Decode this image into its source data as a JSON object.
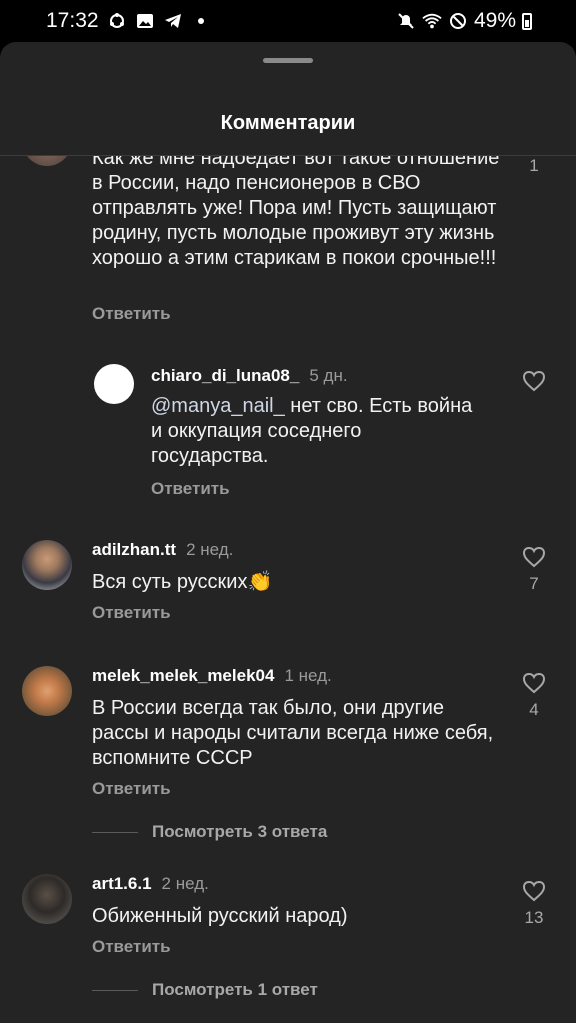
{
  "status": {
    "time": "17:32",
    "battery": "49%"
  },
  "sheet": {
    "title": "Комментарии"
  },
  "comments": [
    {
      "text": "Как же мне надоедает вот такое отношение в России, надо пенсионеров в СВО отправлять уже! Пора им! Пусть защищают родину, пусть молодые проживут эту жизнь хорошо а этим старикам в покои срочные!!!",
      "reply_label": "Ответить",
      "likes": "1"
    },
    {
      "username": "chiaro_di_luna08_",
      "time": "5 дн.",
      "mention": "@manya_nail_",
      "text": " нет сво. Есть война и оккупация соседнего государства.",
      "reply_label": "Ответить"
    },
    {
      "username": "adilzhan.tt",
      "time": "2 нед.",
      "text": "Вся суть русских👏",
      "reply_label": "Ответить",
      "likes": "7"
    },
    {
      "username": "melek_melek_melek04",
      "time": "1 нед.",
      "text": "В России всегда так было, они другие рассы и народы считали всегда ниже себя, вспомните СССР",
      "reply_label": "Ответить",
      "likes": "4",
      "view_replies": "Посмотреть 3 ответа"
    },
    {
      "username": "art1.6.1",
      "time": "2 нед.",
      "text": "Обиженный русский народ)",
      "reply_label": "Ответить",
      "likes": "13",
      "view_replies": "Посмотреть 1 ответ"
    }
  ]
}
